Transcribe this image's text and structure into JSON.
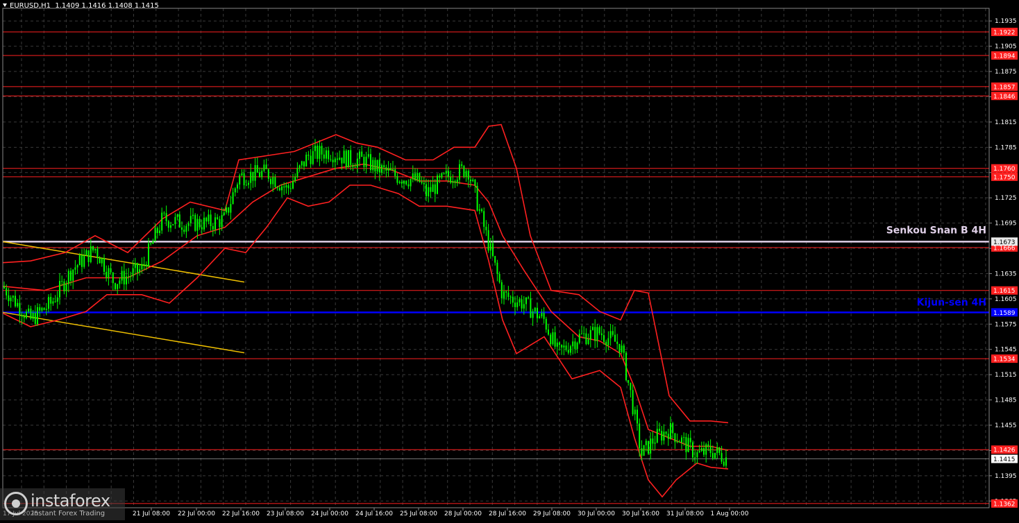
{
  "header": {
    "symbol_tf": "EURUSD,H1",
    "ohlc": "1.1409 1.1416 1.1408 1.1415"
  },
  "logo": {
    "name": "instaforex",
    "tagline": "Instant Forex Trading"
  },
  "chart_data": {
    "type": "candlestick",
    "title": "EURUSD,H1",
    "ylim": [
      1.1357,
      1.195
    ],
    "y_ticks": [
      "1.1935",
      "1.1905",
      "1.1875",
      "1.1845",
      "1.1815",
      "1.1785",
      "1.1755",
      "1.1725",
      "1.1695",
      "1.1665",
      "1.1635",
      "1.1605",
      "1.1575",
      "1.1545",
      "1.1515",
      "1.1485",
      "1.1455",
      "1.1425",
      "1.1395",
      "1.1365"
    ],
    "x_ticks": [
      "21 Jul 08:00",
      "22 Jul 00:00",
      "22 Jul 16:00",
      "23 Jul 08:00",
      "24 Jul 00:00",
      "24 Jul 16:00",
      "25 Jul 08:00",
      "28 Jul 00:00",
      "28 Jul 16:00",
      "29 Jul 08:00",
      "30 Jul 00:00",
      "30 Jul 16:00",
      "31 Jul 08:00",
      "1 Aug 00:00"
    ],
    "first_date_label": "17 Jul 2025",
    "current_price": "1.1415",
    "levels": [
      {
        "value": 1.1922,
        "label": "1.1922",
        "color": "#ff2020"
      },
      {
        "value": 1.1894,
        "label": "1.1894",
        "color": "#ff2020"
      },
      {
        "value": 1.1857,
        "label": "1.1857",
        "color": "#ff2020"
      },
      {
        "value": 1.1846,
        "label": "1.1846",
        "color": "#ff2020"
      },
      {
        "value": 1.176,
        "label": "1.1760",
        "color": "#ff2020"
      },
      {
        "value": 1.175,
        "label": "1.1750",
        "color": "#ff2020"
      },
      {
        "value": 1.1666,
        "label": "1.1666",
        "color": "#ff2020"
      },
      {
        "value": 1.1615,
        "label": "1.1615",
        "color": "#ff2020"
      },
      {
        "value": 1.1534,
        "label": "1.1534",
        "color": "#ff2020"
      },
      {
        "value": 1.1426,
        "label": "1.1426",
        "color": "#ff2020"
      },
      {
        "value": 1.1362,
        "label": "1.1362",
        "color": "#ff2020"
      }
    ],
    "senkou_span_b": {
      "value": 1.1673,
      "label": "1.1673",
      "text": "Senkou Snan B 4H",
      "color": "#e0d0e8"
    },
    "kijun_sen": {
      "value": 1.1589,
      "label": "1.1589",
      "text": "Kijun-sen 4H",
      "color": "#0000ff"
    },
    "price_path": [
      [
        0,
        1.162
      ],
      [
        40,
        1.158
      ],
      [
        70,
        1.16
      ],
      [
        100,
        1.164
      ],
      [
        133,
        1.1665
      ],
      [
        160,
        1.1625
      ],
      [
        200,
        1.164
      ],
      [
        230,
        1.17
      ],
      [
        260,
        1.1695
      ],
      [
        300,
        1.1695
      ],
      [
        320,
        1.17
      ],
      [
        340,
        1.175
      ],
      [
        380,
        1.1755
      ],
      [
        410,
        1.1735
      ],
      [
        440,
        1.1775
      ],
      [
        470,
        1.178
      ],
      [
        500,
        1.177
      ],
      [
        520,
        1.177
      ],
      [
        540,
        1.176
      ],
      [
        570,
        1.175
      ],
      [
        600,
        1.1745
      ],
      [
        610,
        1.173
      ],
      [
        640,
        1.175
      ],
      [
        670,
        1.176
      ],
      [
        680,
        1.173
      ],
      [
        700,
        1.167
      ],
      [
        720,
        1.161
      ],
      [
        750,
        1.16
      ],
      [
        780,
        1.158
      ],
      [
        800,
        1.154
      ],
      [
        830,
        1.156
      ],
      [
        860,
        1.1565
      ],
      [
        890,
        1.155
      ],
      [
        905,
        1.149
      ],
      [
        920,
        1.142
      ],
      [
        940,
        1.144
      ],
      [
        960,
        1.145
      ],
      [
        980,
        1.1435
      ],
      [
        1000,
        1.142
      ],
      [
        1020,
        1.1425
      ],
      [
        1045,
        1.1415
      ]
    ],
    "ichimoku_upper": [
      [
        0,
        1.1648
      ],
      [
        40,
        1.165
      ],
      [
        90,
        1.166
      ],
      [
        133,
        1.168
      ],
      [
        180,
        1.166
      ],
      [
        230,
        1.17
      ],
      [
        270,
        1.172
      ],
      [
        320,
        1.171
      ],
      [
        340,
        1.177
      ],
      [
        380,
        1.1775
      ],
      [
        420,
        1.178
      ],
      [
        450,
        1.179
      ],
      [
        480,
        1.18
      ],
      [
        510,
        1.179
      ],
      [
        540,
        1.1785
      ],
      [
        580,
        1.177
      ],
      [
        620,
        1.177
      ],
      [
        650,
        1.1785
      ],
      [
        680,
        1.1785
      ],
      [
        700,
        1.181
      ],
      [
        718,
        1.1812
      ],
      [
        740,
        1.176
      ],
      [
        760,
        1.168
      ],
      [
        790,
        1.1615
      ],
      [
        830,
        1.161
      ],
      [
        860,
        1.159
      ],
      [
        890,
        1.158
      ],
      [
        910,
        1.1615
      ],
      [
        930,
        1.1612
      ],
      [
        960,
        1.149
      ],
      [
        990,
        1.146
      ],
      [
        1020,
        1.146
      ],
      [
        1045,
        1.1458
      ]
    ],
    "ichimoku_lower": [
      [
        0,
        1.1588
      ],
      [
        40,
        1.1572
      ],
      [
        80,
        1.158
      ],
      [
        120,
        1.159
      ],
      [
        150,
        1.161
      ],
      [
        200,
        1.161
      ],
      [
        240,
        1.16
      ],
      [
        280,
        1.163
      ],
      [
        320,
        1.1665
      ],
      [
        350,
        1.166
      ],
      [
        380,
        1.169
      ],
      [
        410,
        1.1725
      ],
      [
        440,
        1.1715
      ],
      [
        470,
        1.172
      ],
      [
        500,
        1.174
      ],
      [
        530,
        1.174
      ],
      [
        570,
        1.173
      ],
      [
        600,
        1.1715
      ],
      [
        640,
        1.1715
      ],
      [
        680,
        1.171
      ],
      [
        700,
        1.165
      ],
      [
        720,
        1.158
      ],
      [
        740,
        1.154
      ],
      [
        780,
        1.156
      ],
      [
        820,
        1.151
      ],
      [
        860,
        1.152
      ],
      [
        890,
        1.15
      ],
      [
        910,
        1.144
      ],
      [
        930,
        1.139
      ],
      [
        950,
        1.137
      ],
      [
        970,
        1.139
      ],
      [
        1000,
        1.141
      ],
      [
        1020,
        1.1405
      ],
      [
        1045,
        1.1403
      ]
    ],
    "ichimoku_middle": [
      [
        0,
        1.162
      ],
      [
        60,
        1.1615
      ],
      [
        120,
        1.163
      ],
      [
        180,
        1.163
      ],
      [
        230,
        1.165
      ],
      [
        280,
        1.168
      ],
      [
        320,
        1.169
      ],
      [
        360,
        1.172
      ],
      [
        400,
        1.174
      ],
      [
        440,
        1.175
      ],
      [
        480,
        1.176
      ],
      [
        520,
        1.1765
      ],
      [
        560,
        1.1758
      ],
      [
        600,
        1.1745
      ],
      [
        640,
        1.1745
      ],
      [
        680,
        1.174
      ],
      [
        700,
        1.172
      ],
      [
        720,
        1.168
      ],
      [
        750,
        1.164
      ],
      [
        790,
        1.159
      ],
      [
        830,
        1.156
      ],
      [
        860,
        1.1555
      ],
      [
        890,
        1.154
      ],
      [
        910,
        1.15
      ],
      [
        930,
        1.145
      ],
      [
        960,
        1.144
      ],
      [
        990,
        1.143
      ],
      [
        1020,
        1.143
      ],
      [
        1045,
        1.1425
      ]
    ],
    "channel_lines": [
      {
        "from": [
          0,
          1.1673
        ],
        "to": [
          348,
          1.1625
        ],
        "color": "#f0c000"
      },
      {
        "from": [
          0,
          1.1589
        ],
        "to": [
          348,
          1.1541
        ],
        "color": "#f0c000"
      }
    ]
  },
  "colors": {
    "background": "#000000",
    "grid": "#3a3a3a",
    "candles": "#00ff00",
    "indicator": "#ff2020",
    "axis_text": "#ffffff"
  }
}
